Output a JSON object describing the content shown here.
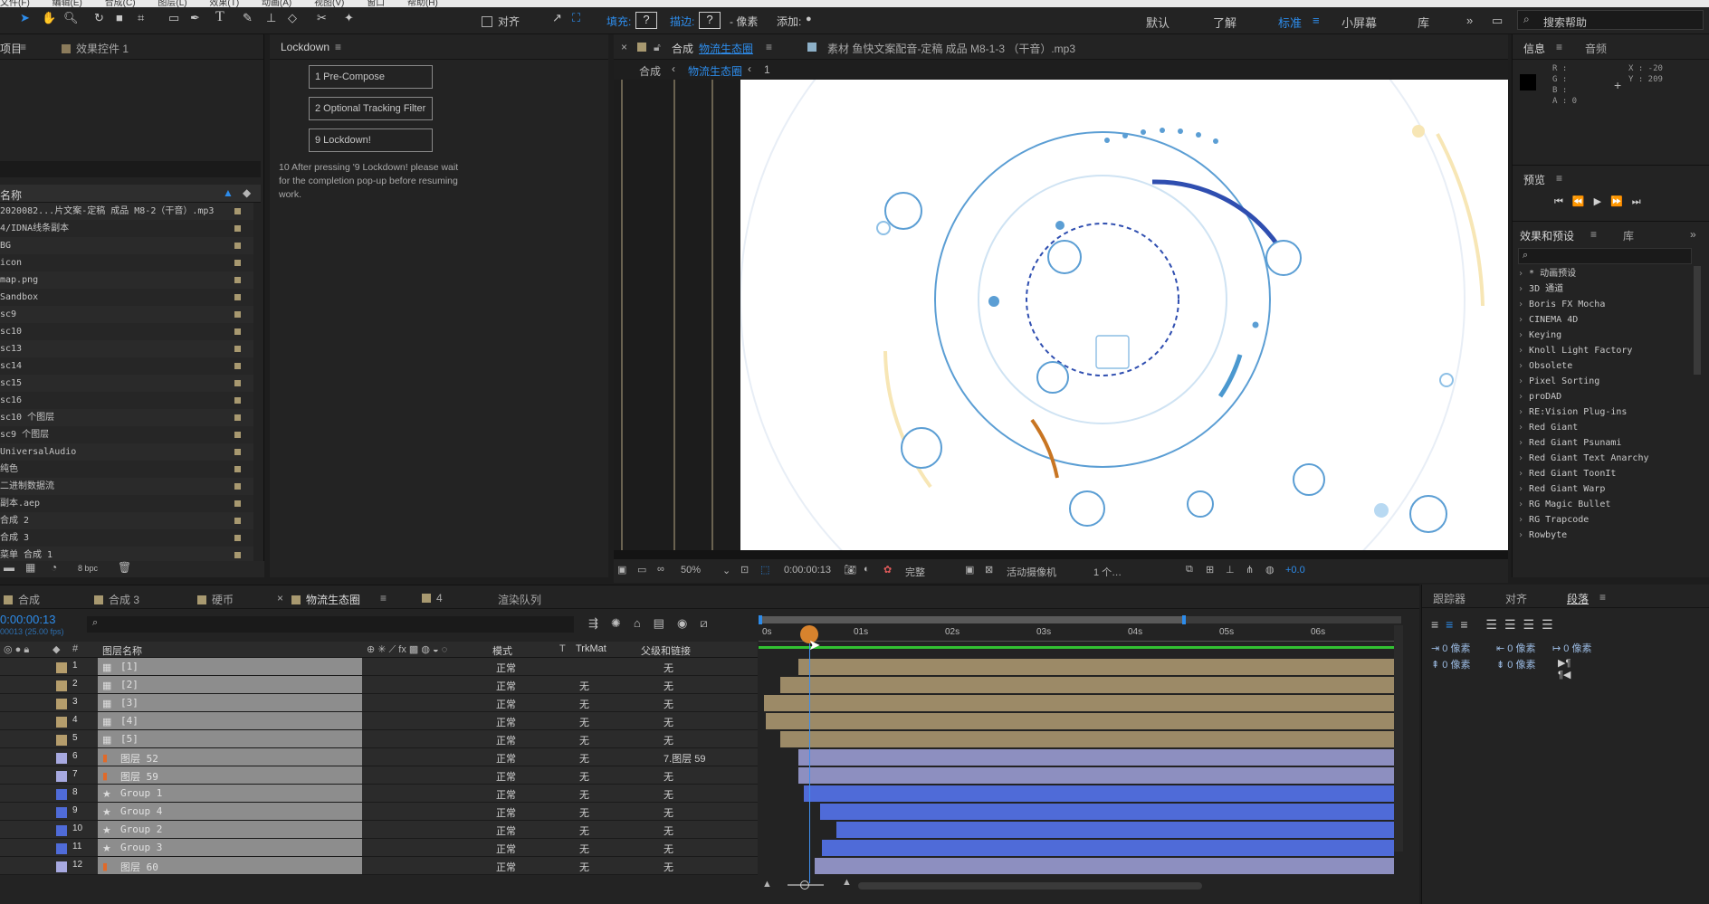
{
  "menubar": {
    "items": [
      "文件(F)",
      "编辑(E)",
      "合成(C)",
      "图层(L)",
      "效果(T)",
      "动画(A)",
      "视图(V)",
      "窗口",
      "帮助(H)"
    ]
  },
  "toolbar": {
    "align_label": "对齐",
    "fill_label": "填充:",
    "stroke_label": "描边:",
    "stroke_units": "- 像素",
    "add_label": "添加:",
    "q": "?"
  },
  "workspaces": {
    "items": [
      "默认",
      "了解",
      "标准",
      "小屏幕",
      "库"
    ],
    "active": "标准",
    "search_placeholder": "搜索帮助"
  },
  "project_panel": {
    "tab": "项目",
    "effect_controls_tab": "效果控件 1",
    "name_header": "名称",
    "depth": "8 bpc",
    "items": [
      "2020082...片文案-定稿 成品 M8-2（干音）.mp3",
      "4/IDNA线条副本",
      "BG",
      "icon",
      "map.png",
      "Sandbox",
      "sc9",
      "sc10",
      "sc13",
      "sc14",
      "sc15",
      "sc16",
      "sc10 个图层",
      "sc9 个图层",
      "UniversalAudio",
      "纯色",
      "二进制数据流",
      "副本.aep",
      "合成 2",
      "合成 3",
      "菜单 合成 1"
    ]
  },
  "lockdown": {
    "tab": "Lockdown",
    "btn1": "1 Pre-Compose",
    "btn2": "2 Optional Tracking Filter",
    "btn3": "9 Lockdown!",
    "note": "10 After pressing '9 Lockdown! please wait for the completion pop-up before resuming work."
  },
  "comp_panel": {
    "tab_label": "合成",
    "tab_name": "物流生态圈",
    "footage_tab": "素材 鱼快文案配音-定稿 成品 M8-1-3 （干音）.mp3",
    "breadcrumb_root": "合成",
    "breadcrumb_active": "物流生态圈",
    "breadcrumb_num": "1",
    "zoom": "50%",
    "timecode": "0:00:00:13",
    "resolution": "完整",
    "camera": "活动摄像机",
    "views": "1 个…",
    "offset": "+0.0"
  },
  "info_panel": {
    "tab": "信息",
    "audio_tab": "音频",
    "r": "R :",
    "g": "G :",
    "b": "B :",
    "a": "A : 0",
    "x": "X : -20",
    "y": "Y : 209"
  },
  "preview_panel": {
    "tab": "预览"
  },
  "effects_panel": {
    "tab": "效果和预设",
    "lib_tab": "库",
    "items": [
      "* 动画预设",
      "3D 通道",
      "Boris FX Mocha",
      "CINEMA 4D",
      "Keying",
      "Knoll Light Factory",
      "Obsolete",
      "Pixel Sorting",
      "proDAD",
      "RE:Vision Plug-ins",
      "Red Giant",
      "Red Giant Psunami",
      "Red Giant Text Anarchy",
      "Red Giant ToonIt",
      "Red Giant Warp",
      "RG Magic Bullet",
      "RG Trapcode",
      "Rowbyte"
    ]
  },
  "timeline": {
    "tabs": [
      "合成",
      "合成 3",
      "硬币",
      "物流生态圈",
      "4",
      "渲染队列"
    ],
    "active_tab": "物流生态圈",
    "timecode": "0:00:00:13",
    "fps": "00013 (25.00 fps)",
    "headers": {
      "layer_name": "图层名称",
      "mode": "模式",
      "t": "T",
      "trkmat": "TrkMat",
      "parent": "父级和链接"
    },
    "ruler": [
      "0s",
      "01s",
      "02s",
      "03s",
      "04s",
      "05s",
      "06s"
    ],
    "layers": [
      {
        "n": "1",
        "name": "[1]",
        "mode": "正常",
        "trk": "",
        "parent": "无",
        "color": "#b59d6c",
        "type": "comp"
      },
      {
        "n": "2",
        "name": "[2]",
        "mode": "正常",
        "trk": "无",
        "parent": "无",
        "color": "#b59d6c",
        "type": "comp"
      },
      {
        "n": "3",
        "name": "[3]",
        "mode": "正常",
        "trk": "无",
        "parent": "无",
        "color": "#b59d6c",
        "type": "comp"
      },
      {
        "n": "4",
        "name": "[4]",
        "mode": "正常",
        "trk": "无",
        "parent": "无",
        "color": "#b59d6c",
        "type": "comp"
      },
      {
        "n": "5",
        "name": "[5]",
        "mode": "正常",
        "trk": "无",
        "parent": "无",
        "color": "#b59d6c",
        "type": "comp"
      },
      {
        "n": "6",
        "name": "图层 52",
        "mode": "正常",
        "trk": "无",
        "parent": "7.图层 59",
        "color": "#a7a9e0",
        "type": "ai"
      },
      {
        "n": "7",
        "name": "图层 59",
        "mode": "正常",
        "trk": "无",
        "parent": "无",
        "color": "#a7a9e0",
        "type": "ai"
      },
      {
        "n": "8",
        "name": "Group 1",
        "mode": "正常",
        "trk": "无",
        "parent": "无",
        "color": "#4f6bd8",
        "type": "shape"
      },
      {
        "n": "9",
        "name": "Group 4",
        "mode": "正常",
        "trk": "无",
        "parent": "无",
        "color": "#4f6bd8",
        "type": "shape"
      },
      {
        "n": "10",
        "name": "Group 2",
        "mode": "正常",
        "trk": "无",
        "parent": "无",
        "color": "#4f6bd8",
        "type": "shape"
      },
      {
        "n": "11",
        "name": "Group 3",
        "mode": "正常",
        "trk": "无",
        "parent": "无",
        "color": "#4f6bd8",
        "type": "shape"
      },
      {
        "n": "12",
        "name": "图层 60",
        "mode": "正常",
        "trk": "无",
        "parent": "无",
        "color": "#a7a9e0",
        "type": "ai"
      }
    ]
  },
  "paragraph_panel": {
    "tracker_tab": "跟踪器",
    "align_tab": "对齐",
    "para_tab": "段落",
    "px": "0 像素"
  }
}
